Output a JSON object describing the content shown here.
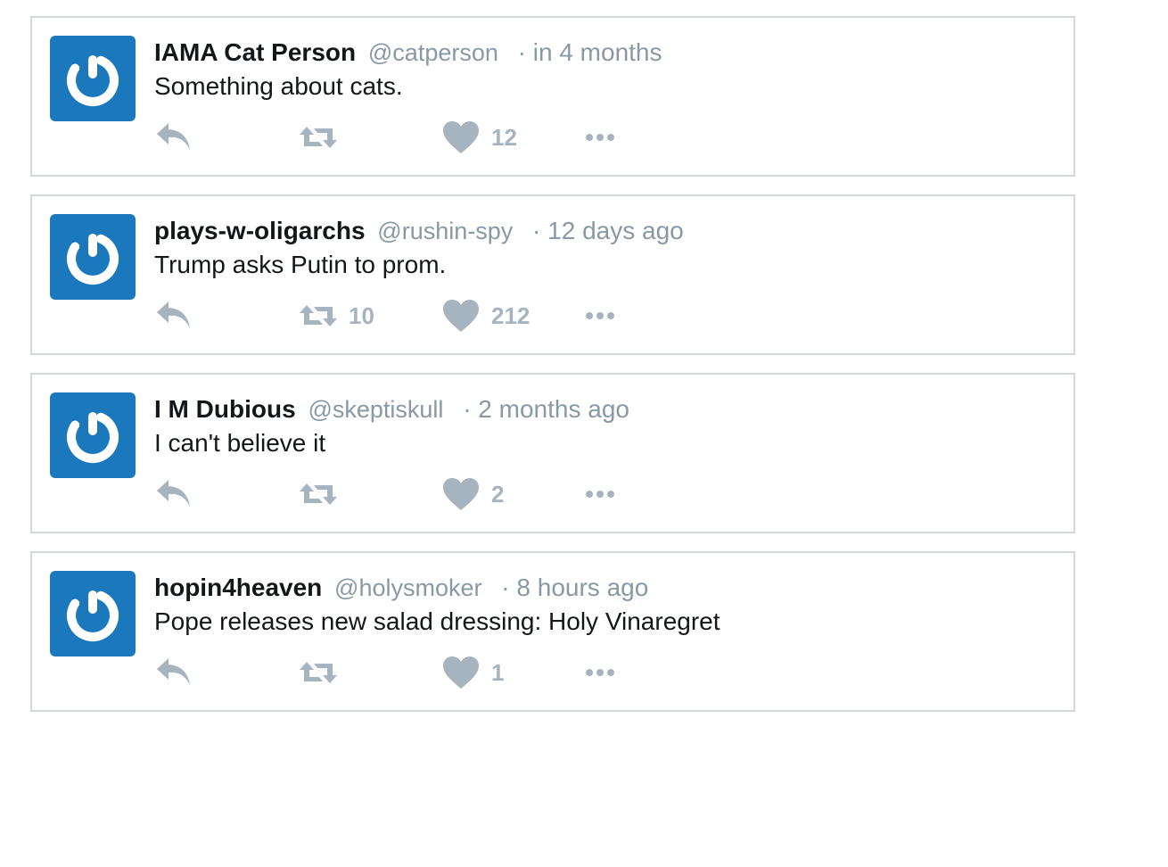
{
  "colors": {
    "avatar_bg": "#1b78bd",
    "icon": "#a6b4bf",
    "meta_text": "#8899a6",
    "border": "#d6d9dc"
  },
  "icons": {
    "avatar": "power-icon",
    "reply": "reply-icon",
    "retweet": "retweet-icon",
    "like": "heart-icon",
    "more": "more-dots-icon"
  },
  "tweets": [
    {
      "fullname": "IAMA Cat Person",
      "handle": "@catperson",
      "time": "· in 4 months",
      "text": "Something about cats.",
      "retweets": "",
      "likes": "12"
    },
    {
      "fullname": "plays-w-oligarchs",
      "handle": "@rushin-spy",
      "time": "· 12 days ago",
      "text": "Trump asks Putin to prom.",
      "retweets": "10",
      "likes": "212"
    },
    {
      "fullname": "I M Dubious",
      "handle": "@skeptiskull",
      "time": "· 2 months ago",
      "text": "I can't believe it",
      "retweets": "",
      "likes": "2"
    },
    {
      "fullname": "hopin4heaven",
      "handle": "@holysmoker",
      "time": "· 8 hours ago",
      "text": "Pope releases new salad dressing: Holy Vinaregret",
      "retweets": "",
      "likes": "1"
    }
  ]
}
